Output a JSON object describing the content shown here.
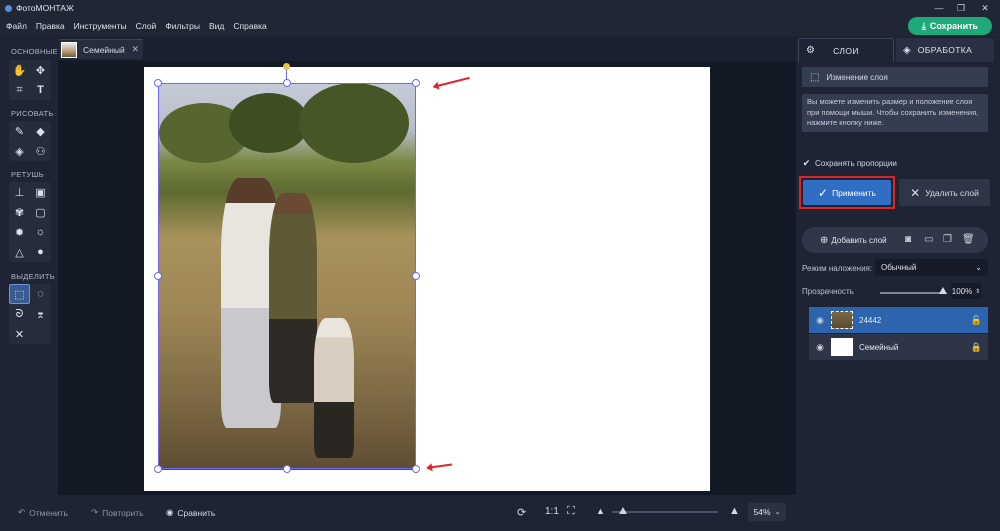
{
  "window": {
    "title": "ФотоМОНТАЖ",
    "controls": [
      "—",
      "❐",
      "✕"
    ]
  },
  "menu": [
    "Файл",
    "Правка",
    "Инструменты",
    "Слой",
    "Фильтры",
    "Вид",
    "Справка"
  ],
  "save_button": "Сохранить",
  "document_tab": {
    "name": "Семейный",
    "close": "✕"
  },
  "toolbox": {
    "sections": [
      "ОСНОВНЫЕ",
      "РИСОВАТЬ",
      "РЕТУШЬ",
      "ВЫДЕЛИТЬ"
    ],
    "tools": {
      "basic": [
        "hand-icon",
        "move-icon",
        "crop-icon",
        "text-icon"
      ],
      "draw": [
        "brush-icon",
        "eraser-icon",
        "fill-icon",
        "shapes-icon"
      ],
      "retouch": [
        "stamp-icon",
        "healing-icon",
        "patch-icon",
        "frame-icon",
        "brightness-icon",
        "contrast-icon",
        "sharpen-icon",
        "blur-icon"
      ],
      "select": [
        "rect-select-icon",
        "ellipse-select-icon",
        "lasso-icon",
        "polygon-lasso-icon",
        "magic-wand-icon"
      ]
    }
  },
  "right_panel": {
    "tabs": [
      "СЛОИ",
      "ОБРАБОТКА"
    ],
    "layer_change_label": "Изменение слоя",
    "info_text": "Вы можете изменить размер и положение слоя при помощи мыши. Чтобы сохранить изменения, нажмите кнопку ниже.",
    "keep_proportions": "Сохранять пропорции",
    "apply_button": "Применить",
    "delete_button": "Удалить слой",
    "add_layer_button": "Добавить слой",
    "blend_mode_label": "Режим наложения:",
    "blend_mode_value": "Обычный",
    "opacity_label": "Прозрачность",
    "opacity_value": "100%",
    "layers": [
      {
        "name": "24442",
        "selected": true
      },
      {
        "name": "Семейный",
        "selected": false
      }
    ]
  },
  "bottom_bar": {
    "undo": "Отменить",
    "redo": "Повторить",
    "compare": "Сравнить",
    "one_to_one": "1:1",
    "zoom_value": "54%"
  },
  "colors": {
    "accent_green": "#1fa97a",
    "accent_blue": "#2f6ec3",
    "highlight_red": "#e02328",
    "selection": "#6a6bf0"
  }
}
